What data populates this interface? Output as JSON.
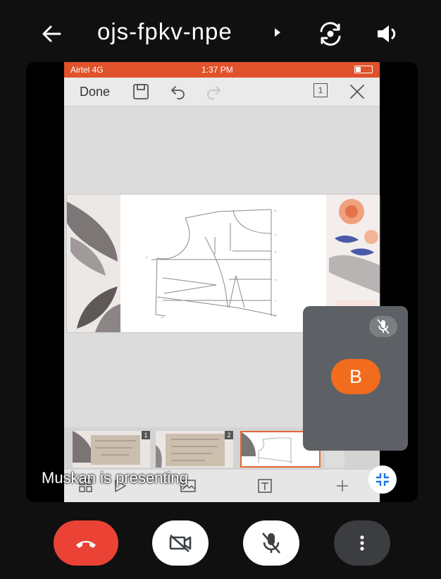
{
  "header": {
    "meeting_code": "ojs-fpkv-npe"
  },
  "status_bar": {
    "carrier": "Airtel  4G",
    "time": "1:37 PM"
  },
  "app_toolbar": {
    "done_label": "Done",
    "slide_count_badge": "1"
  },
  "thumbnails": [
    {
      "number": "1"
    },
    {
      "number": "2"
    },
    {
      "number": ""
    }
  ],
  "presenting_text": "Muskan is presenting",
  "participant": {
    "initial": "B"
  },
  "colors": {
    "end_call": "#ea4335",
    "avatar": "#f26c1e",
    "status_bar": "#e0522b"
  }
}
